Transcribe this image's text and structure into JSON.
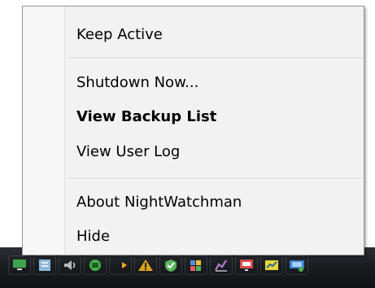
{
  "menu": {
    "items": [
      {
        "label": "Keep Active",
        "bold": false
      },
      {
        "label": "Shutdown Now...",
        "bold": false
      },
      {
        "label": "View Backup List",
        "bold": true
      },
      {
        "label": "View User Log",
        "bold": false
      },
      {
        "label": "About NightWatchman",
        "bold": false
      },
      {
        "label": "Hide",
        "bold": false
      }
    ]
  },
  "taskbar": {
    "tray_icons": [
      {
        "name": "green-pc-icon",
        "color": "#3fa34d"
      },
      {
        "name": "document-icon",
        "color": "#8fb8d8"
      },
      {
        "name": "speaker-icon",
        "color": "#b8b8b8"
      },
      {
        "name": "network-icon",
        "color": "#3dae46"
      },
      {
        "name": "arrow-icon",
        "color": "#f5a623"
      },
      {
        "name": "warning-icon",
        "color": "#d7a21f"
      },
      {
        "name": "shield-icon",
        "color": "#5ab45c"
      },
      {
        "name": "flag-icon",
        "color": "#5b8bd8"
      },
      {
        "name": "chart-icon",
        "color": "#b07ac9"
      },
      {
        "name": "display-icon",
        "color": "#d54b4b"
      },
      {
        "name": "volume-graph-icon",
        "color": "#e6d43a"
      },
      {
        "name": "monitor-network-icon",
        "color": "#3d7fc9"
      }
    ]
  }
}
